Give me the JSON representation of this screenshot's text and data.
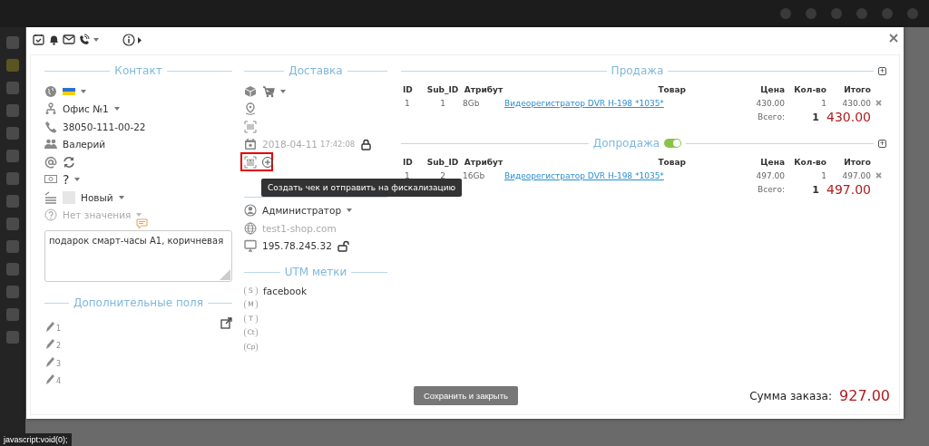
{
  "status_link": "javascript:void(0);",
  "contact": {
    "title": "Контакт",
    "office": "Офис №1",
    "phone": "38050-111-00-22",
    "name": "Валерий",
    "payment": "?",
    "status": "Новый",
    "source_placeholder": "Нет значения",
    "comment": "подарок смарт-часы А1, коричневая"
  },
  "extra_fields": {
    "title": "Дополнительные поля",
    "fields": [
      "1",
      "2",
      "3",
      "4"
    ]
  },
  "delivery": {
    "title": "Доставка",
    "date": "2018-04-11",
    "time": "17:42:08",
    "locked": true
  },
  "tooltip": "Создать чек и отправить на фискализацию",
  "info": {
    "user": "Администратор",
    "site": "test1-shop.com",
    "ip": "195.78.245.32",
    "ip_locked": false
  },
  "utm": {
    "title": "UTM метки",
    "items": [
      {
        "label": "S",
        "value": "facebook"
      },
      {
        "label": "M"
      },
      {
        "label": "T"
      },
      {
        "label": "Ct"
      },
      {
        "label": "Cp"
      }
    ]
  },
  "sections": [
    {
      "title": "Продажа",
      "columns": [
        "ID",
        "Sub_ID",
        "Атрибут",
        "Товар",
        "Цена",
        "Кол-во",
        "Итого"
      ],
      "rows": [
        {
          "id": "1",
          "sub_id": "1",
          "attribute": "8Gb",
          "product": "Видеорегистратор DVR H-198 *1035*",
          "price": "430.00",
          "qty": "1",
          "total": "430.00"
        }
      ],
      "total_label": "Всего:",
      "total_qty": "1",
      "total": "430.00",
      "add_button": "+"
    },
    {
      "title": "Допродажа",
      "enabled": true,
      "columns": [
        "ID",
        "Sub_ID",
        "Атрибут",
        "Товар",
        "Цена",
        "Кол-во",
        "Итого"
      ],
      "rows": [
        {
          "id": "1",
          "sub_id": "2",
          "attribute": "16Gb",
          "product": "Видеорегистратор DVR H-198 *1035*",
          "price": "497.00",
          "qty": "1",
          "total": "497.00"
        }
      ],
      "total_label": "Всего:",
      "total_qty": "1",
      "total": "497.00",
      "add_button": "+"
    }
  ],
  "save_button": "Сохранить и закрыть",
  "order_sum": {
    "label": "Сумма заказа:",
    "value": "927.00"
  }
}
